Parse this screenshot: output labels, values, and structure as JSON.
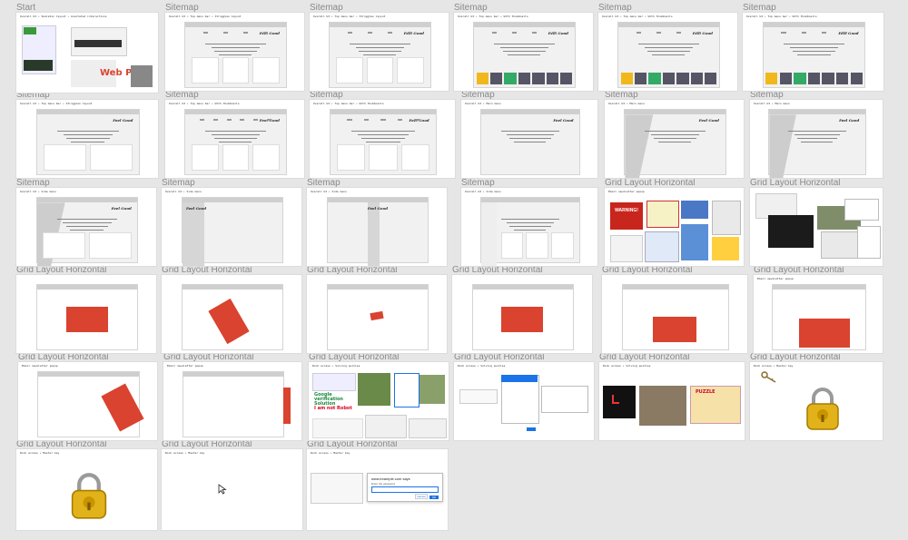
{
  "sections": {
    "start": "Start",
    "sitemap": "Sitemap",
    "grid_layout_horizontal": "Grid Layout Horizontal"
  },
  "start_frame": {
    "web_page_label": "Web Page"
  },
  "captions": {
    "a": "Overall UI • Skeleton layout • Annotated interactions",
    "b": "Overall UI • Top menu bar • Struggles layout",
    "c": "Overall UI • Top menu bar • With thumbnails",
    "d": "Overall UI • Main menu",
    "e": "Overall UI • Side menu",
    "f": "Email newsletter popup",
    "g": "Rock access • Solving puzzles",
    "h": "Rock access • Master key"
  },
  "site": {
    "logo": "Feel Good"
  },
  "popups": {
    "warning": "WARNING!",
    "captcha_title": "Google verification Solution",
    "not_robot": "I am not Robot",
    "puzzle": "PUZZLE"
  },
  "dialog": {
    "title": "www.example.com says",
    "prompt": "Enter the password",
    "ok": "OK",
    "cancel": "Cancel"
  },
  "colors": {
    "background": "#e6e6e6",
    "frame": "#ffffff",
    "popup_red": "#d9432f",
    "label_gray": "#8a8a8a",
    "lock_gold": "#e2b21a"
  }
}
